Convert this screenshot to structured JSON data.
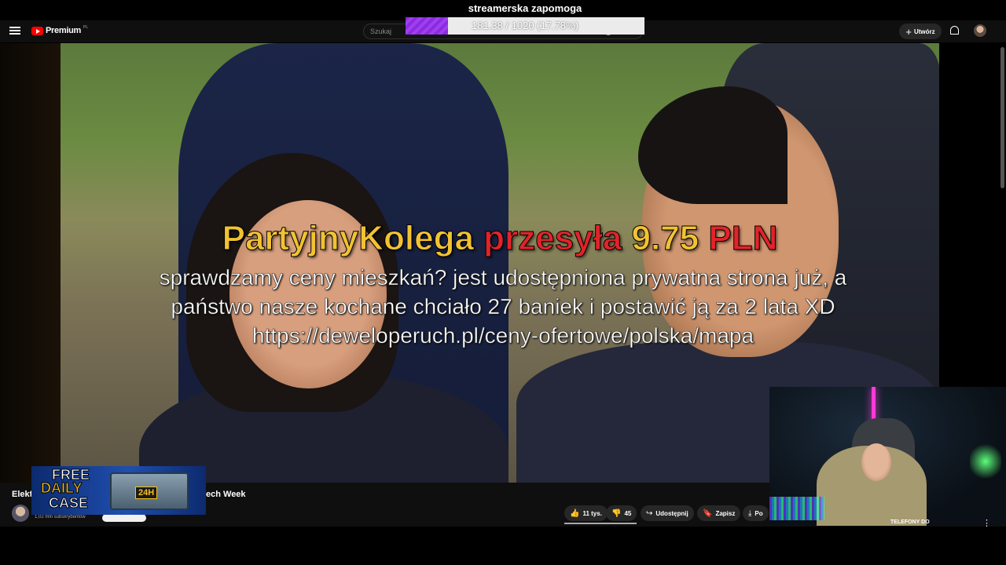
{
  "header": {
    "logo_text": "Premium",
    "logo_sup": "PL",
    "search_placeholder": "Szukaj",
    "create_label": "Utwórz"
  },
  "goal": {
    "title": "streamerska zapomoga",
    "progress_text": "181.38 / 1020 (17.78%)",
    "current": 181.38,
    "target": 1020,
    "percent": 17.78,
    "fill_color": "#8a2be2"
  },
  "donation": {
    "name": "PartyjnyKolega",
    "verb": "przesyła",
    "amount": "9.75",
    "currency": "PLN",
    "message": "sprawdzamy ceny mieszkań? jest udostępniona prywatna strona już, a państwo nasze kochane chciało 27 baniek i postawić ją za 2 lata XD https://deweloperuch.pl/ceny-ofertowe/polska/mapa"
  },
  "video": {
    "title_start": "Elekt",
    "title_end": "ech Week",
    "subscribers": "1,02 mln subskrybentów"
  },
  "actions": {
    "likes": "11 tys.",
    "dislikes": "45",
    "share": "Udostępnij",
    "save": "Zapisz",
    "download": "Po"
  },
  "promo": {
    "line1": "FREE",
    "line2": "DAILY",
    "line3": "CASE",
    "badge": "24H"
  },
  "webcam": {
    "label": "TELEFONY DO"
  },
  "icons": {
    "menu": "menu-icon",
    "search": "search-icon",
    "mic": "mic-icon",
    "bell": "bell-icon",
    "like": "thumb-up-icon",
    "dislike": "thumb-down-icon",
    "share": "share-icon",
    "save": "bookmark-icon",
    "download": "download-icon",
    "more": "more-vert-icon"
  }
}
